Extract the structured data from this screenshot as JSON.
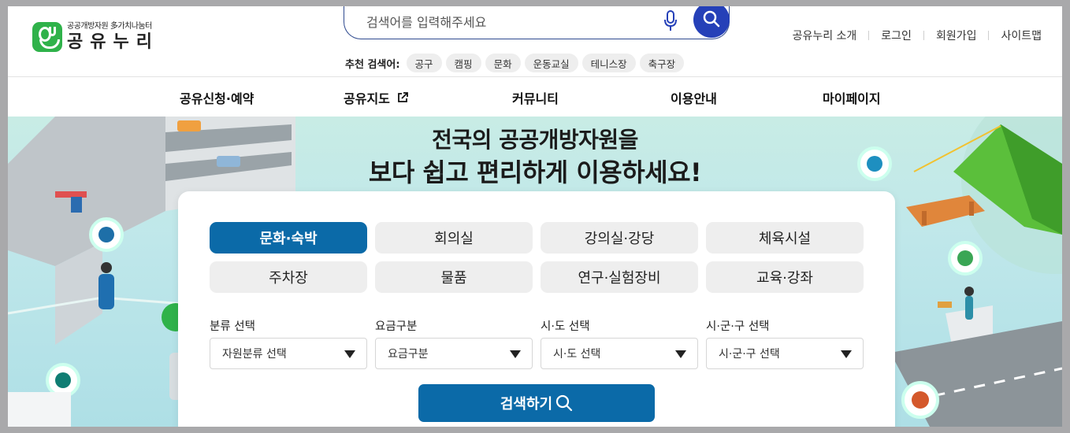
{
  "logo": {
    "subtitle": "공공개방자원 多가치나눔터",
    "name": "공유누리"
  },
  "search": {
    "placeholder": "검색어를 입력해주세요"
  },
  "recommended": {
    "label": "추천 검색어:",
    "keywords": [
      "공구",
      "캠핑",
      "문화",
      "운동교실",
      "테니스장",
      "축구장"
    ]
  },
  "util_links": [
    "공유누리 소개",
    "로그인",
    "회원가입",
    "사이트맵"
  ],
  "nav": [
    "공유신청·예약",
    "공유지도",
    "커뮤니티",
    "이용안내",
    "마이페이지"
  ],
  "hero": {
    "line1": "전국의 공공개방자원을",
    "line2": "보다 쉽고 편리하게 이용하세요!"
  },
  "categories": [
    {
      "label": "문화·숙박",
      "active": true
    },
    {
      "label": "회의실",
      "active": false
    },
    {
      "label": "강의실·강당",
      "active": false
    },
    {
      "label": "체육시설",
      "active": false
    },
    {
      "label": "주차장",
      "active": false
    },
    {
      "label": "물품",
      "active": false
    },
    {
      "label": "연구·실험장비",
      "active": false
    },
    {
      "label": "교육·강좌",
      "active": false
    }
  ],
  "filters": [
    {
      "label": "분류 선택",
      "value": "자원분류 선택"
    },
    {
      "label": "요금구분",
      "value": "요금구분"
    },
    {
      "label": "시·도 선택",
      "value": "시·도 선택"
    },
    {
      "label": "시·군·구 선택",
      "value": "시·군·구 선택"
    }
  ],
  "search_button": "검색하기",
  "colors": {
    "brand_green": "#2fb24a",
    "primary_blue": "#0b6aa8",
    "search_blue": "#2540b8"
  }
}
